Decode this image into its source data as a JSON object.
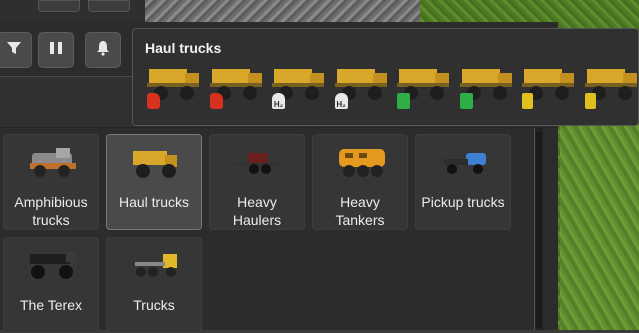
{
  "tooltip": {
    "title": "Haul trucks",
    "variants": [
      {
        "fuel": "diesel",
        "fuel_icon": "fuel-canister-icon",
        "mark": ""
      },
      {
        "fuel": "diesel",
        "fuel_icon": "fuel-canister-icon",
        "mark": ""
      },
      {
        "fuel": "hydrogen",
        "fuel_icon": "hydrogen-tank-icon",
        "mark": "H₂"
      },
      {
        "fuel": "hydrogen",
        "fuel_icon": "hydrogen-tank-icon",
        "mark": "H₂"
      },
      {
        "fuel": "electric",
        "fuel_icon": "green-canister-icon",
        "mark": ""
      },
      {
        "fuel": "electric",
        "fuel_icon": "green-canister-icon",
        "mark": ""
      },
      {
        "fuel": "battery",
        "fuel_icon": "battery-icon",
        "mark": ""
      },
      {
        "fuel": "battery",
        "fuel_icon": "battery-icon",
        "mark": ""
      }
    ]
  },
  "toolbar": {
    "filter_icon": "filter-icon",
    "pause_icon": "pause-icon",
    "bell_icon": "bell-icon"
  },
  "categories": [
    {
      "id": "amphibious",
      "label": "Amphibious\ntrucks",
      "lines": [
        "Amphibious",
        "trucks"
      ]
    },
    {
      "id": "haul",
      "label": "Haul trucks",
      "lines": [
        "Haul trucks"
      ],
      "selected": true
    },
    {
      "id": "heavy-haulers",
      "lines": [
        "Heavy",
        "Haulers"
      ]
    },
    {
      "id": "heavy-tankers",
      "lines": [
        "Heavy",
        "Tankers"
      ]
    },
    {
      "id": "pickup",
      "lines": [
        "Pickup trucks"
      ]
    },
    {
      "id": "terex",
      "lines": [
        "The Terex"
      ]
    },
    {
      "id": "trucks",
      "lines": [
        "Trucks"
      ]
    }
  ],
  "colors": {
    "panel": "#2c2c2c",
    "tile": "#363636",
    "tile_selected": "#4a4a4a",
    "truck_yellow": "#d9a82b"
  }
}
